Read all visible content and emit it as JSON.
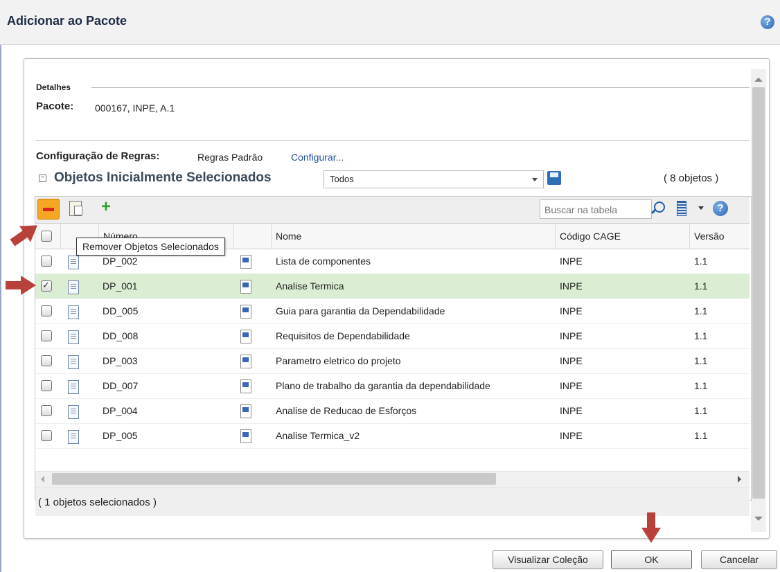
{
  "dialog": {
    "title": "Adicionar ao Pacote",
    "details_label": "Detalhes",
    "pacote_label": "Pacote:",
    "pacote_value": "000167, INPE, A.1",
    "regras_label": "Configuração de Regras:",
    "regras_value": "Regras Padrão",
    "regras_link": "Configurar...",
    "section_title": "Objetos Inicialmente Selecionados",
    "filter_value": "Todos",
    "count": "( 8 objetos )",
    "search_placeholder": "Buscar na tabela",
    "tooltip": "Remover Objetos Selecionados",
    "selected_footer": "( 1 objetos selecionados )"
  },
  "table": {
    "headers": {
      "numero": "Número",
      "nome": "Nome",
      "codigo": "Código CAGE",
      "versao": "Versão"
    },
    "rows": [
      {
        "numero": "DP_002",
        "nome": "Lista de componentes",
        "codigo": "INPE",
        "versao": "1.1",
        "checked": false
      },
      {
        "numero": "DP_001",
        "nome": "Analise Termica",
        "codigo": "INPE",
        "versao": "1.1",
        "checked": true
      },
      {
        "numero": "DD_005",
        "nome": "Guia para garantia da Dependabilidade",
        "codigo": "INPE",
        "versao": "1.1",
        "checked": false
      },
      {
        "numero": "DD_008",
        "nome": "Requisitos de Dependabilidade",
        "codigo": "INPE",
        "versao": "1.1",
        "checked": false
      },
      {
        "numero": "DP_003",
        "nome": "Parametro eletrico do projeto",
        "codigo": "INPE",
        "versao": "1.1",
        "checked": false
      },
      {
        "numero": "DD_007",
        "nome": "Plano de trabalho da garantia da dependabilidade",
        "codigo": "INPE",
        "versao": "1.1",
        "checked": false
      },
      {
        "numero": "DP_004",
        "nome": "Analise de Reducao de Esforços",
        "codigo": "INPE",
        "versao": "1.1",
        "checked": false
      },
      {
        "numero": "DP_005",
        "nome": "Analise Termica_v2",
        "codigo": "INPE",
        "versao": "1.1",
        "checked": false
      }
    ]
  },
  "buttons": {
    "visualizar": "Visualizar Coleção",
    "ok": "OK",
    "cancelar": "Cancelar"
  },
  "colors": {
    "selected_row": "#dbeed4",
    "arrow": "#b8413b",
    "remove_button": "#f5a623"
  }
}
